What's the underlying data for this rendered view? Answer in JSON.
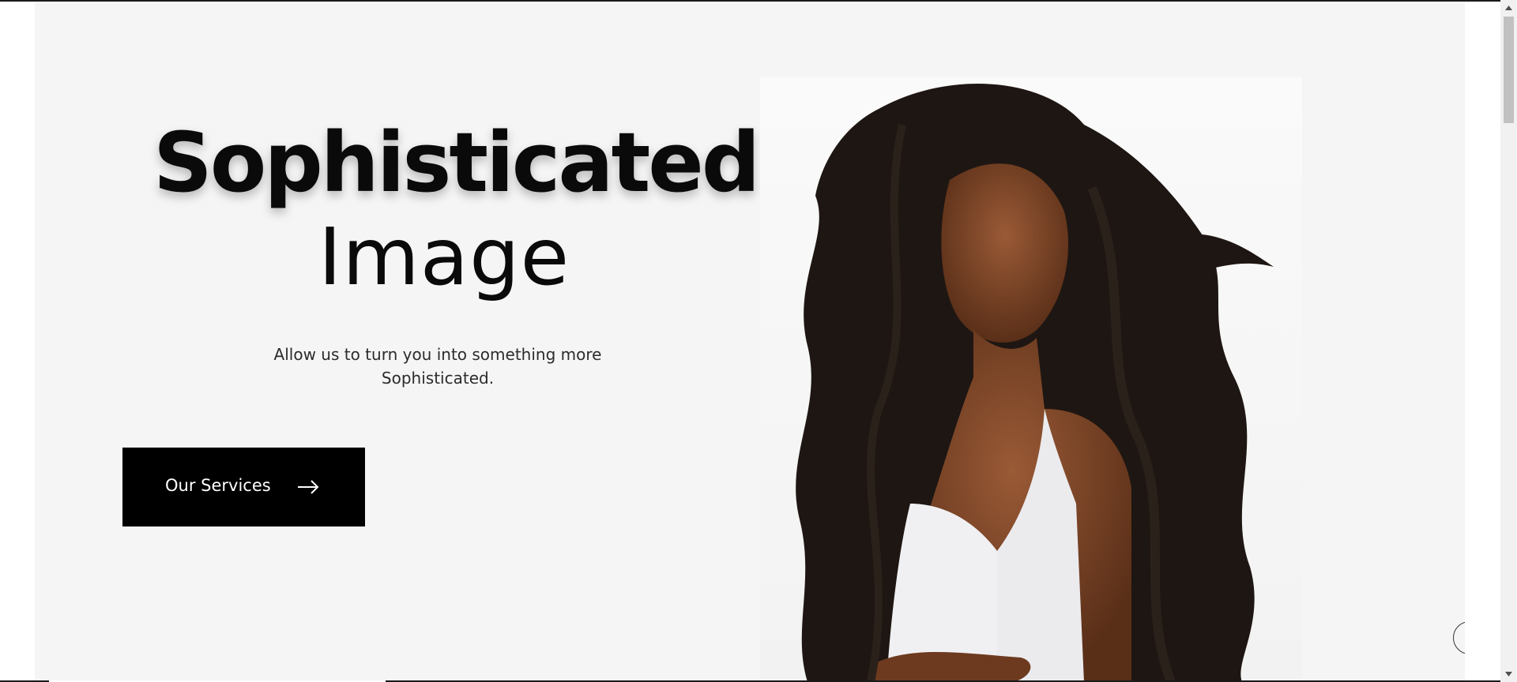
{
  "hero": {
    "headline_bold": "Sophisticated",
    "headline_light": "Image",
    "tagline": "Allow us to turn you into something more Sophisticated.",
    "cta_label": "Our Services",
    "cta_icon": "arrow-right-icon",
    "image_icon": "model-photo",
    "scroll_top_icon": "arrow-up-icon"
  },
  "colors": {
    "hero_background": "#f5f5f5",
    "cta_background": "#000000",
    "cta_text": "#ffffff",
    "headline": "#0a0a0a"
  }
}
